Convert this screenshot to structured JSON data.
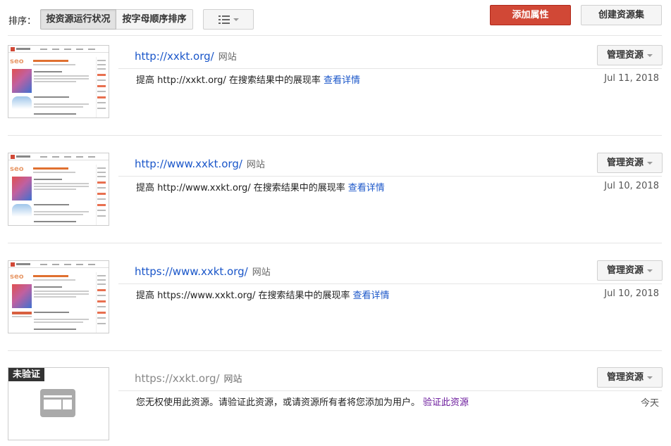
{
  "toolbar": {
    "sort_label": "排序：",
    "sort_by_health": "按资源运行状况",
    "sort_alpha": "按字母顺序排序",
    "add_property": "添加属性",
    "create_set": "创建资源集"
  },
  "properties": [
    {
      "url": "http://xxkt.org/",
      "type": "网站",
      "manage": "管理资源",
      "desc_prefix": "提高 http://xxkt.org/ 在搜索结果中的展现率",
      "link": "查看详情",
      "date": "Jul 11, 2018",
      "verified": true
    },
    {
      "url": "http://www.xxkt.org/",
      "type": "网站",
      "manage": "管理资源",
      "desc_prefix": "提高 http://www.xxkt.org/ 在搜索结果中的展现率",
      "link": "查看详情",
      "date": "Jul 10, 2018",
      "verified": true
    },
    {
      "url": "https://www.xxkt.org/",
      "type": "网站",
      "manage": "管理资源",
      "desc_prefix": "提高 https://www.xxkt.org/ 在搜索结果中的展现率",
      "link": "查看详情",
      "date": "Jul 10, 2018",
      "verified": true
    },
    {
      "url": "https://xxkt.org/",
      "type": "网站",
      "manage": "管理资源",
      "badge": "未验证",
      "desc_prefix": "您无权使用此资源。请验证此资源，或请资源所有者将您添加为用户。",
      "link": "验证此资源",
      "date": "今天",
      "verified": false
    }
  ],
  "thumbnail": {
    "seo_text": "seo"
  },
  "icons": {
    "view": "list-view-icon",
    "dropdown": "chevron-down-icon",
    "unverified_site": "website-placeholder-icon"
  },
  "colors": {
    "primary_button": "#d14836",
    "link": "#1a56c9",
    "visited_link": "#6b1a9c"
  }
}
